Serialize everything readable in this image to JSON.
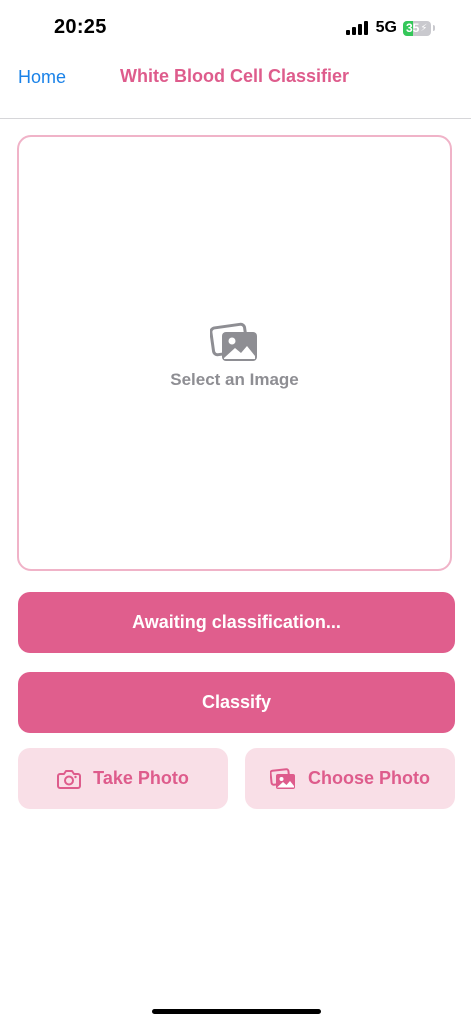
{
  "status_bar": {
    "time": "20:25",
    "network": "5G",
    "battery_level": "35",
    "battery_fraction": 0.35,
    "signal_bars": 4
  },
  "nav": {
    "back_label": "Home",
    "title": "White Blood Cell Classifier"
  },
  "image_picker": {
    "label": "Select an Image",
    "icon": "photo-stack-icon"
  },
  "classification": {
    "status_text": "Awaiting classification...",
    "classify_label": "Classify"
  },
  "actions": {
    "take_photo_label": "Take Photo",
    "take_photo_icon": "camera-icon",
    "choose_photo_label": "Choose Photo",
    "choose_photo_icon": "photo-library-icon"
  },
  "colors": {
    "accent_pink": "#e05e8d",
    "light_pink": "#f9dfe7",
    "border_pink": "#f0b3c8",
    "link_blue": "#1a82e8",
    "placeholder_gray": "#8e8e93",
    "battery_green": "#34c759"
  }
}
